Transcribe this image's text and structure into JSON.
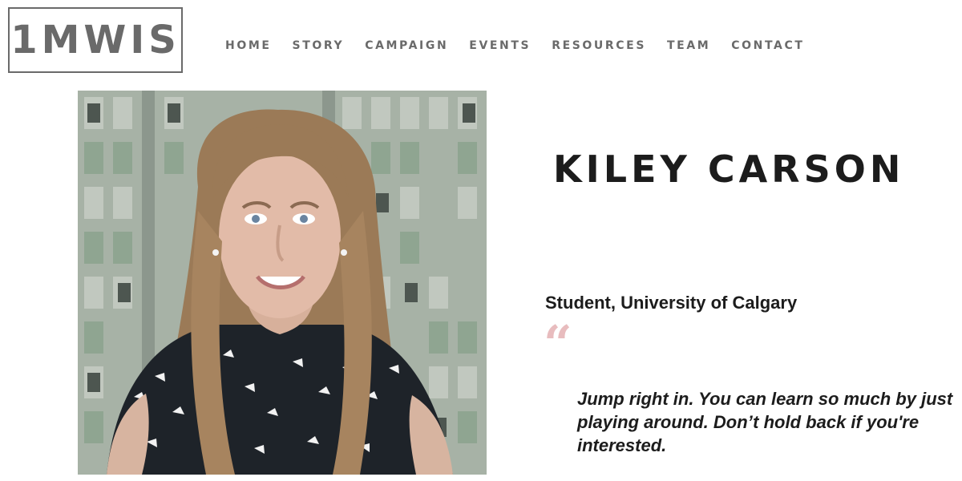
{
  "header": {
    "logo": "1MWIS",
    "nav": [
      {
        "label": "HOME"
      },
      {
        "label": "STORY"
      },
      {
        "label": "CAMPAIGN"
      },
      {
        "label": "EVENTS"
      },
      {
        "label": "RESOURCES"
      },
      {
        "label": "TEAM"
      },
      {
        "label": "CONTACT"
      }
    ]
  },
  "profile": {
    "name": "KILEY CARSON",
    "role": "Student, University of Calgary",
    "quote_mark": "“",
    "quote": "Jump right in. You can learn so much by just playing around. Don’t hold back if you're interested."
  },
  "colors": {
    "nav_text": "#6a6a6a",
    "heading_text": "#1c1c1c",
    "quote_mark": "#e8bcbe"
  },
  "icons": {
    "quote": "quote-mark-icon"
  }
}
